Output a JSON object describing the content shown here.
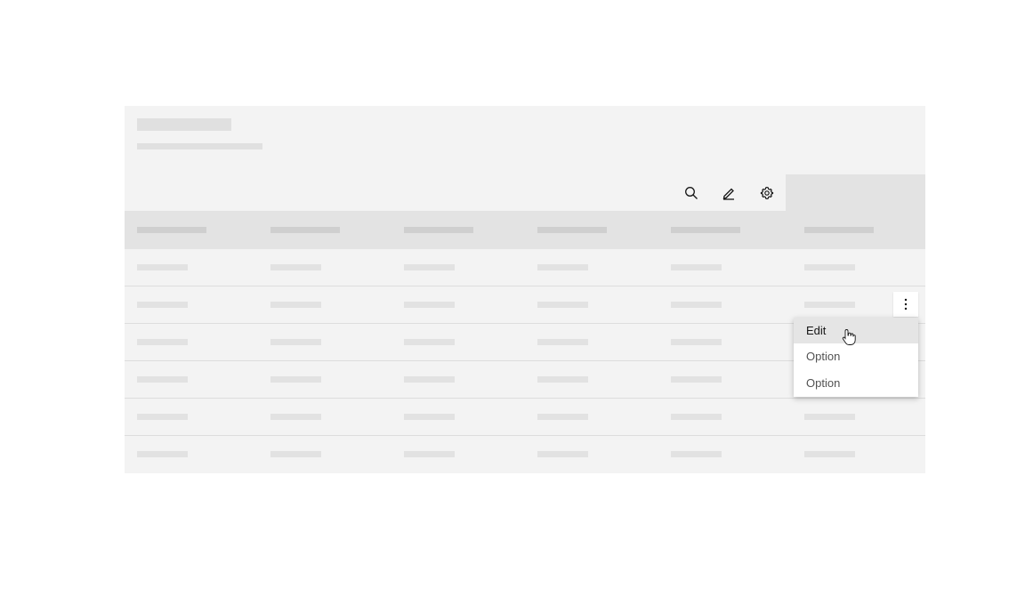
{
  "toolbar": {
    "icons": [
      "search-icon",
      "edit-icon",
      "settings-icon"
    ]
  },
  "table": {
    "columns": 6,
    "rows": 6
  },
  "overflow_menu": {
    "icon": "overflow-menu-vertical-icon",
    "items": [
      {
        "label": "Edit",
        "hovered": true
      },
      {
        "label": "Option",
        "hovered": false
      },
      {
        "label": "Option",
        "hovered": false
      }
    ]
  },
  "colors": {
    "card_bg": "#f3f3f3",
    "header_row_bg": "#e3e3e3",
    "skeleton": "#e2e2e2",
    "menu_hover": "#e5e5e5"
  }
}
